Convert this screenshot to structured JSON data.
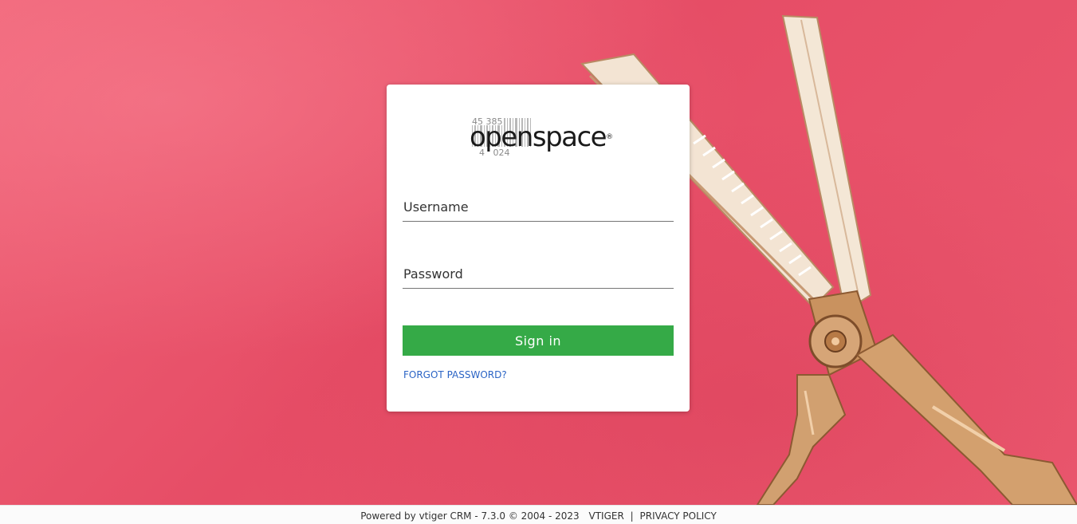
{
  "brand": {
    "logo_text": "openspace",
    "logo_registered": "®",
    "barcode_top": "45 385",
    "barcode_bottom": "4   024"
  },
  "login": {
    "username_placeholder": "Username",
    "password_placeholder": "Password",
    "signin_label": "Sign in",
    "forgot_label": "FORGOT PASSWORD?"
  },
  "footer": {
    "powered_by": "Powered by vtiger CRM - 7.3.0  © 2004 - 2023",
    "vtiger_link": "VTIGER",
    "separator": "|",
    "privacy_link": "PRIVACY POLICY"
  },
  "colors": {
    "background": "#e8546a",
    "signin_button": "#35aa47",
    "link": "#2b64c5"
  },
  "icons": {
    "background_image": "thinning-scissors-image"
  }
}
